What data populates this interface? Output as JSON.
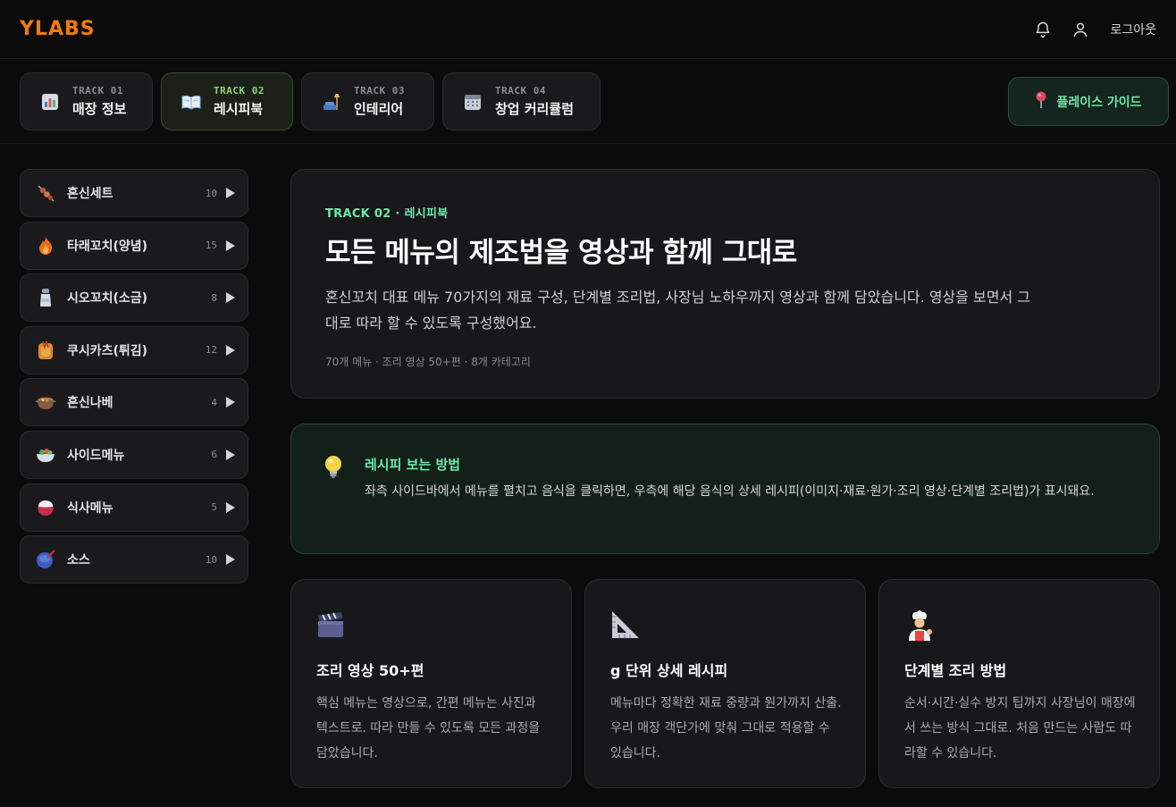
{
  "header": {
    "logo": "YLABS",
    "logout_label": "로그아웃"
  },
  "tracks": [
    {
      "no": "TRACK 01",
      "name": "매장 정보",
      "icon": "bar-chart-icon",
      "active": false
    },
    {
      "no": "TRACK 02",
      "name": "레시피북",
      "icon": "open-book-icon",
      "active": true
    },
    {
      "no": "TRACK 03",
      "name": "인테리어",
      "icon": "lamp-icon",
      "active": false
    },
    {
      "no": "TRACK 04",
      "name": "창업 커리큘럼",
      "icon": "calendar-icon",
      "active": false
    }
  ],
  "guide_button": {
    "label": "플레이스 가이드",
    "icon": "pin-icon"
  },
  "sidebar": {
    "items": [
      {
        "label": "혼신세트",
        "count": "10",
        "icon": "skewer-icon"
      },
      {
        "label": "타래꼬치(양념)",
        "count": "15",
        "icon": "fire-icon"
      },
      {
        "label": "시오꼬치(소금)",
        "count": "8",
        "icon": "salt-shaker-icon"
      },
      {
        "label": "쿠시카츠(튀김)",
        "count": "12",
        "icon": "fried-icon"
      },
      {
        "label": "혼신나베",
        "count": "4",
        "icon": "hot-pot-icon"
      },
      {
        "label": "사이드메뉴",
        "count": "6",
        "icon": "salad-icon"
      },
      {
        "label": "식사메뉴",
        "count": "5",
        "icon": "rice-icon"
      },
      {
        "label": "소스",
        "count": "10",
        "icon": "sauce-icon"
      }
    ]
  },
  "hero": {
    "eyebrow": "TRACK 02 · 레시피북",
    "title": "모든 메뉴의 제조법을 영상과 함께 그대로",
    "description": "혼신꼬치 대표 메뉴 70가지의 재료 구성, 단계별 조리법, 사장님 노하우까지 영상과 함께 담았습니다. 영상을 보면서 그대로 따라 할 수 있도록 구성했어요.",
    "meta": "70개 메뉴 · 조리 영상 50+편 · 8개 카테고리"
  },
  "tip": {
    "title": "레시피 보는 방법",
    "description": "좌측 사이드바에서 메뉴를 펼치고 음식을 클릭하면, 우측에 해당 음식의 상세 레시피(이미지·재료·원가·조리 영상·단계별 조리법)가 표시돼요.",
    "icon": "lightbulb-icon"
  },
  "features": [
    {
      "title": "조리 영상 50+편",
      "description": "핵심 메뉴는 영상으로, 간편 메뉴는 사진과 텍스트로. 따라 만들 수 있도록 모든 과정을 담았습니다.",
      "icon": "clapper-icon"
    },
    {
      "title": "g 단위 상세 레시피",
      "description": "메뉴마다 정확한 재료 중량과 원가까지 산출. 우리 매장 객단가에 맞춰 그대로 적용할 수 있습니다.",
      "icon": "ruler-triangle-icon"
    },
    {
      "title": "단계별 조리 방법",
      "description": "순서·시간·실수 방지 팁까지 사장님이 매장에서 쓰는 방식 그대로. 처음 만드는 사람도 따라할 수 있습니다.",
      "icon": "chef-icon"
    }
  ],
  "colors": {
    "brand": "#f07b12",
    "accent_green": "#6ee7a8",
    "background": "#0b0b0c"
  }
}
